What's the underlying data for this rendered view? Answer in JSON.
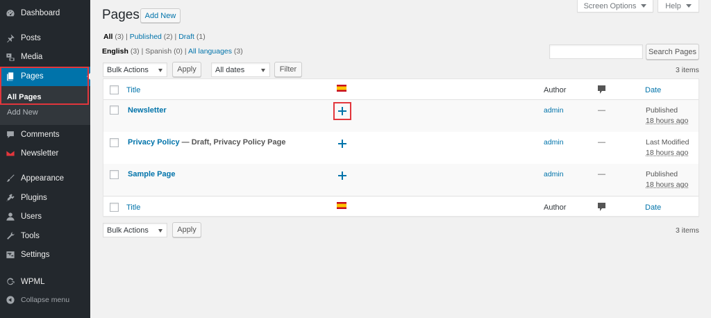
{
  "sidebar": {
    "items": [
      {
        "label": "Dashboard",
        "icon": "dashboard-icon"
      },
      {
        "label": "Posts",
        "icon": "pin-icon"
      },
      {
        "label": "Media",
        "icon": "media-icon"
      },
      {
        "label": "Pages",
        "icon": "pages-icon"
      },
      {
        "label": "Comments",
        "icon": "comment-icon"
      },
      {
        "label": "Newsletter",
        "icon": "envelope-icon"
      },
      {
        "label": "Appearance",
        "icon": "brush-icon"
      },
      {
        "label": "Plugins",
        "icon": "plugin-icon"
      },
      {
        "label": "Users",
        "icon": "user-icon"
      },
      {
        "label": "Tools",
        "icon": "wrench-icon"
      },
      {
        "label": "Settings",
        "icon": "settings-icon"
      },
      {
        "label": "WPML",
        "icon": "wpml-icon"
      },
      {
        "label": "Collapse menu",
        "icon": "collapse-icon"
      }
    ],
    "submenu": {
      "current": "All Pages",
      "add_new": "Add New"
    }
  },
  "header": {
    "title": "Pages",
    "add_new": "Add New",
    "screen_options": "Screen Options",
    "help": "Help"
  },
  "filters": {
    "status": {
      "all_label": "All",
      "all_count": "(3)",
      "published_label": "Published",
      "published_count": "(2)",
      "draft_label": "Draft",
      "draft_count": "(1)"
    },
    "languages": {
      "english_label": "English",
      "english_count": "(3)",
      "spanish_label": "Spanish",
      "spanish_count": "(0)",
      "all_label": "All languages",
      "all_count": "(3)"
    },
    "bulk_actions": "Bulk Actions",
    "apply": "Apply",
    "dates": "All dates",
    "filter": "Filter",
    "search_button": "Search Pages",
    "items_count": "3 items"
  },
  "table": {
    "columns": {
      "title": "Title",
      "author": "Author",
      "date": "Date"
    },
    "rows": [
      {
        "title": "Newsletter",
        "state": "",
        "author": "admin",
        "comments": "—",
        "date_status": "Published",
        "date_ago": "18 hours ago"
      },
      {
        "title": "Privacy Policy",
        "state": " — Draft, Privacy Policy Page",
        "author": "admin",
        "comments": "—",
        "date_status": "Last Modified",
        "date_ago": "18 hours ago"
      },
      {
        "title": "Sample Page",
        "state": "",
        "author": "admin",
        "comments": "—",
        "date_status": "Published",
        "date_ago": "18 hours ago"
      }
    ]
  },
  "colors": {
    "sidebar_bg": "#23282d",
    "active_bg": "#0073aa",
    "link": "#0073aa",
    "highlight": "#e2363c",
    "plus": "#0073aa"
  }
}
